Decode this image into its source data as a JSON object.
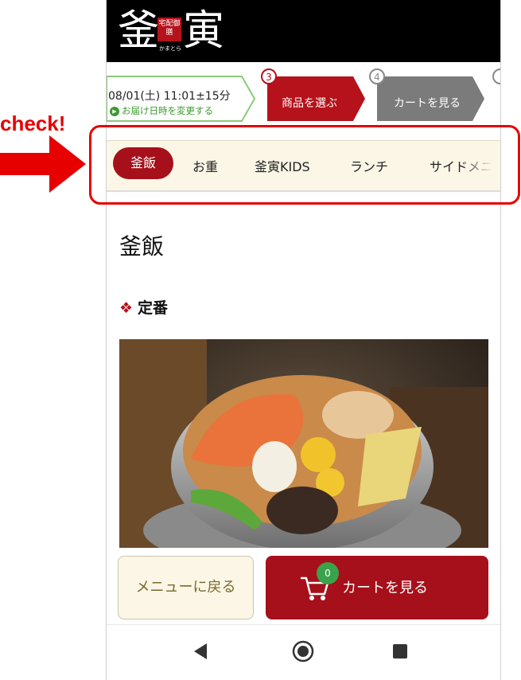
{
  "annotation": {
    "label": "check!",
    "color": "#e60000"
  },
  "header": {
    "logo_left": "釜",
    "logo_badge": "宅配御膳",
    "logo_kana": "かまとら",
    "logo_right": "寅"
  },
  "steps": {
    "datetime": "08/01(土) 11:01±15分",
    "change_link": "お届け日時を変更する",
    "items": [
      {
        "num": "3",
        "label": "商品を選ぶ",
        "state": "active"
      },
      {
        "num": "4",
        "label": "カートを見る",
        "state": "inactive"
      }
    ]
  },
  "categories": [
    {
      "label": "釜飯",
      "active": true
    },
    {
      "label": "お重",
      "active": false
    },
    {
      "label": "釜寅KIDS",
      "active": false
    },
    {
      "label": "ランチ",
      "active": false
    },
    {
      "label": "サイドメニ",
      "active": false
    }
  ],
  "page": {
    "title": "釜飯",
    "section": "定番",
    "section_icon": "diamond-icon"
  },
  "bottom": {
    "back_label": "メニューに戻る",
    "cart_label": "カートを見る",
    "cart_count": "0"
  },
  "colors": {
    "brand_red": "#a6101a",
    "accent_green": "#3aa24a",
    "cream": "#fbf6e6"
  }
}
